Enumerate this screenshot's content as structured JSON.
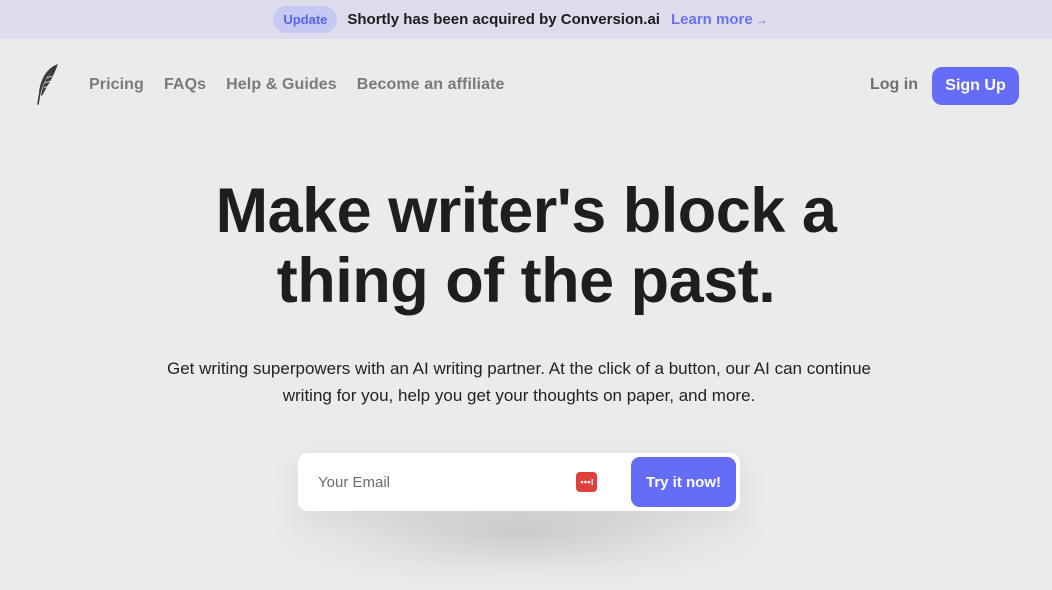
{
  "banner": {
    "badge": "Update",
    "text": "Shortly has been acquired by Conversion.ai",
    "link_label": "Learn more",
    "link_arrow": "→"
  },
  "nav": {
    "logo_icon": "quill-feather-icon",
    "links": [
      "Pricing",
      "FAQs",
      "Help & Guides",
      "Become an affiliate"
    ],
    "login_label": "Log in",
    "signup_label": "Sign Up"
  },
  "hero": {
    "title_line1": "Make writer's block a",
    "title_line2": "thing of the past.",
    "subtitle": "Get writing superpowers with an AI writing partner. At the click of a button, our AI can continue writing for you, help you get your thoughts on paper, and more."
  },
  "signup_form": {
    "email_placeholder": "Your Email",
    "email_value": "",
    "password_manager_icon": "password-manager-icon",
    "submit_label": "Try it now!"
  },
  "colors": {
    "accent": "#656cf7",
    "banner_bg": "#dcdcec",
    "page_bg": "#ebebeb",
    "badge_bg": "#c5c9f4",
    "password_icon": "#e0403c"
  }
}
